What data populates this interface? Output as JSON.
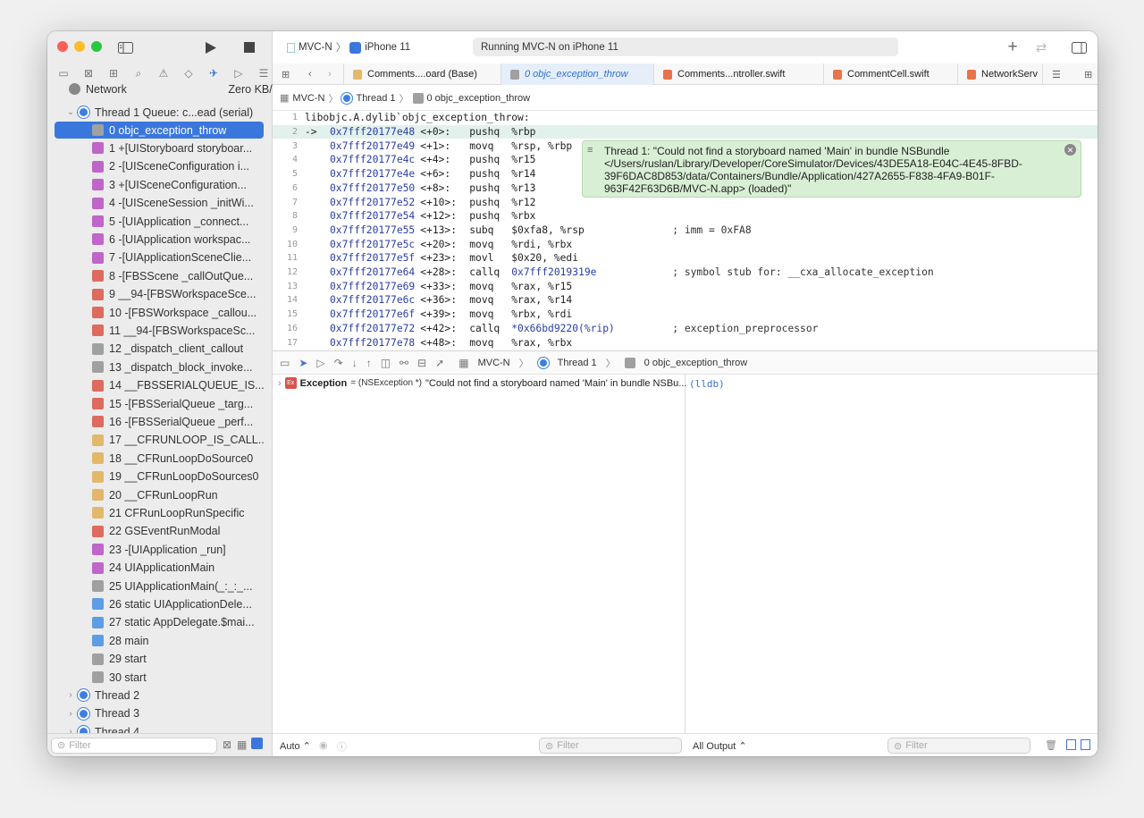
{
  "toolbar": {
    "scheme": "MVC-N",
    "device": "iPhone 11",
    "status": "Running MVC-N on iPhone 11"
  },
  "sidebar": {
    "network_label": "Network",
    "network_rate": "Zero KB/s",
    "thread1_label": "Thread 1",
    "thread1_queue": "Queue: c...ead (serial)",
    "frames": [
      {
        "label": "0 objc_exception_throw",
        "color": "#a0a0a0"
      },
      {
        "label": "1 +[UIStoryboard storyboar...",
        "color": "#c065c9"
      },
      {
        "label": "2 -[UISceneConfiguration i...",
        "color": "#c065c9"
      },
      {
        "label": "3 +[UISceneConfiguration...",
        "color": "#c065c9"
      },
      {
        "label": "4 -[UISceneSession _initWi...",
        "color": "#c065c9"
      },
      {
        "label": "5 -[UIApplication _connect...",
        "color": "#c065c9"
      },
      {
        "label": "6 -[UIApplication workspac...",
        "color": "#c065c9"
      },
      {
        "label": "7 -[UIApplicationSceneClie...",
        "color": "#c065c9"
      },
      {
        "label": "8 -[FBSScene _callOutQue...",
        "color": "#de6b5d"
      },
      {
        "label": "9 __94-[FBSWorkspaceSce...",
        "color": "#de6b5d"
      },
      {
        "label": "10 -[FBSWorkspace _callou...",
        "color": "#de6b5d"
      },
      {
        "label": "11 __94-[FBSWorkspaceSc...",
        "color": "#de6b5d"
      },
      {
        "label": "12 _dispatch_client_callout",
        "color": "#a0a0a0"
      },
      {
        "label": "13 _dispatch_block_invoke...",
        "color": "#a0a0a0"
      },
      {
        "label": "14 __FBSSERIALQUEUE_IS...",
        "color": "#de6b5d"
      },
      {
        "label": "15 -[FBSSerialQueue _targ...",
        "color": "#de6b5d"
      },
      {
        "label": "16 -[FBSSerialQueue _perf...",
        "color": "#de6b5d"
      },
      {
        "label": "17 __CFRUNLOOP_IS_CALL...",
        "color": "#e3b86a"
      },
      {
        "label": "18 __CFRunLoopDoSource0",
        "color": "#e3b86a"
      },
      {
        "label": "19 __CFRunLoopDoSources0",
        "color": "#e3b86a"
      },
      {
        "label": "20 __CFRunLoopRun",
        "color": "#e3b86a"
      },
      {
        "label": "21 CFRunLoopRunSpecific",
        "color": "#e3b86a"
      },
      {
        "label": "22 GSEventRunModal",
        "color": "#de6b5d"
      },
      {
        "label": "23 -[UIApplication _run]",
        "color": "#c065c9"
      },
      {
        "label": "24 UIApplicationMain",
        "color": "#c065c9"
      },
      {
        "label": "25 UIApplicationMain(_:_:_...",
        "color": "#a0a0a0"
      },
      {
        "label": "26 static UIApplicationDele...",
        "color": "#5c9de6"
      },
      {
        "label": "27 static AppDelegate.$mai...",
        "color": "#5c9de6"
      },
      {
        "label": "28 main",
        "color": "#5c9de6"
      },
      {
        "label": "29 start",
        "color": "#a0a0a0"
      },
      {
        "label": "30 start",
        "color": "#a0a0a0"
      }
    ],
    "other_threads": [
      "Thread 2",
      "Thread 3",
      "Thread 4"
    ],
    "filter_placeholder": "Filter"
  },
  "tabs": [
    {
      "label": "Comments....oard (Base)",
      "color": "#e3b86a"
    },
    {
      "label": "0 objc_exception_throw",
      "color": "#a0a0a0"
    },
    {
      "label": "Comments...ntroller.swift",
      "color": "#e8734a"
    },
    {
      "label": "CommentCell.swift",
      "color": "#e8734a"
    },
    {
      "label": "NetworkServ",
      "color": "#e8734a"
    }
  ],
  "jumpbar": {
    "project": "MVC-N",
    "thread": "Thread 1",
    "frame": "0 objc_exception_throw"
  },
  "code_title": "libobjc.A.dylib`objc_exception_throw:",
  "code_lines": [
    {
      "n": "2",
      "arrow": "->",
      "addr": "0x7fff20177e48",
      "off": "<+0>:",
      "op": "pushq",
      "args": "%rbp",
      "comment": ""
    },
    {
      "n": "3",
      "arrow": "",
      "addr": "0x7fff20177e49",
      "off": "<+1>:",
      "op": "movq",
      "args": "%rsp, %rbp",
      "comment": ""
    },
    {
      "n": "4",
      "arrow": "",
      "addr": "0x7fff20177e4c",
      "off": "<+4>:",
      "op": "pushq",
      "args": "%r15",
      "comment": ""
    },
    {
      "n": "5",
      "arrow": "",
      "addr": "0x7fff20177e4e",
      "off": "<+6>:",
      "op": "pushq",
      "args": "%r14",
      "comment": ""
    },
    {
      "n": "6",
      "arrow": "",
      "addr": "0x7fff20177e50",
      "off": "<+8>:",
      "op": "pushq",
      "args": "%r13",
      "comment": ""
    },
    {
      "n": "7",
      "arrow": "",
      "addr": "0x7fff20177e52",
      "off": "<+10>:",
      "op": "pushq",
      "args": "%r12",
      "comment": ""
    },
    {
      "n": "8",
      "arrow": "",
      "addr": "0x7fff20177e54",
      "off": "<+12>:",
      "op": "pushq",
      "args": "%rbx",
      "comment": ""
    },
    {
      "n": "9",
      "arrow": "",
      "addr": "0x7fff20177e55",
      "off": "<+13>:",
      "op": "subq",
      "args": "$0xfa8, %rsp",
      "comment": "; imm = 0xFA8"
    },
    {
      "n": "10",
      "arrow": "",
      "addr": "0x7fff20177e5c",
      "off": "<+20>:",
      "op": "movq",
      "args": "%rdi, %rbx",
      "comment": ""
    },
    {
      "n": "11",
      "arrow": "",
      "addr": "0x7fff20177e5f",
      "off": "<+23>:",
      "op": "movl",
      "args": "$0x20, %edi",
      "comment": ""
    },
    {
      "n": "12",
      "arrow": "",
      "addr": "0x7fff20177e64",
      "off": "<+28>:",
      "op": "callq",
      "args": "0x7fff2019319e",
      "comment": "; symbol stub for: __cxa_allocate_exception"
    },
    {
      "n": "13",
      "arrow": "",
      "addr": "0x7fff20177e69",
      "off": "<+33>:",
      "op": "movq",
      "args": "%rax, %r15",
      "comment": ""
    },
    {
      "n": "14",
      "arrow": "",
      "addr": "0x7fff20177e6c",
      "off": "<+36>:",
      "op": "movq",
      "args": "%rax, %r14",
      "comment": ""
    },
    {
      "n": "15",
      "arrow": "",
      "addr": "0x7fff20177e6f",
      "off": "<+39>:",
      "op": "movq",
      "args": "%rbx, %rdi",
      "comment": ""
    },
    {
      "n": "16",
      "arrow": "",
      "addr": "0x7fff20177e72",
      "off": "<+42>:",
      "op": "callq",
      "args": "*0x66bd9220(%rip)",
      "comment": "; exception_preprocessor"
    },
    {
      "n": "17",
      "arrow": "",
      "addr": "0x7fff20177e78",
      "off": "<+48>:",
      "op": "movq",
      "args": "%rax, %rbx",
      "comment": ""
    }
  ],
  "error_banner": "Thread 1: \"Could not find a storyboard named 'Main' in bundle NSBundle </Users/ruslan/Library/Developer/CoreSimulator/Devices/43DE5A18-E04C-4E45-8FBD-39F6DAC8D853/data/Containers/Bundle/Application/427A2655-F838-4FA9-B01F-963F42F63D6B/MVC-N.app> (loaded)\"",
  "debug_bar": {
    "project": "MVC-N",
    "thread": "Thread 1",
    "frame": "0 objc_exception_throw"
  },
  "variables": {
    "name": "Exception",
    "type": "= (NSException *)",
    "value": "\"Could not find a storyboard named 'Main' in bundle NSBu..."
  },
  "console": {
    "prompt": "(lldb)"
  },
  "bottom": {
    "auto_label": "Auto ⌃",
    "filter_placeholder": "Filter",
    "output_label": "All Output ⌃",
    "console_filter_placeholder": "Filter"
  }
}
